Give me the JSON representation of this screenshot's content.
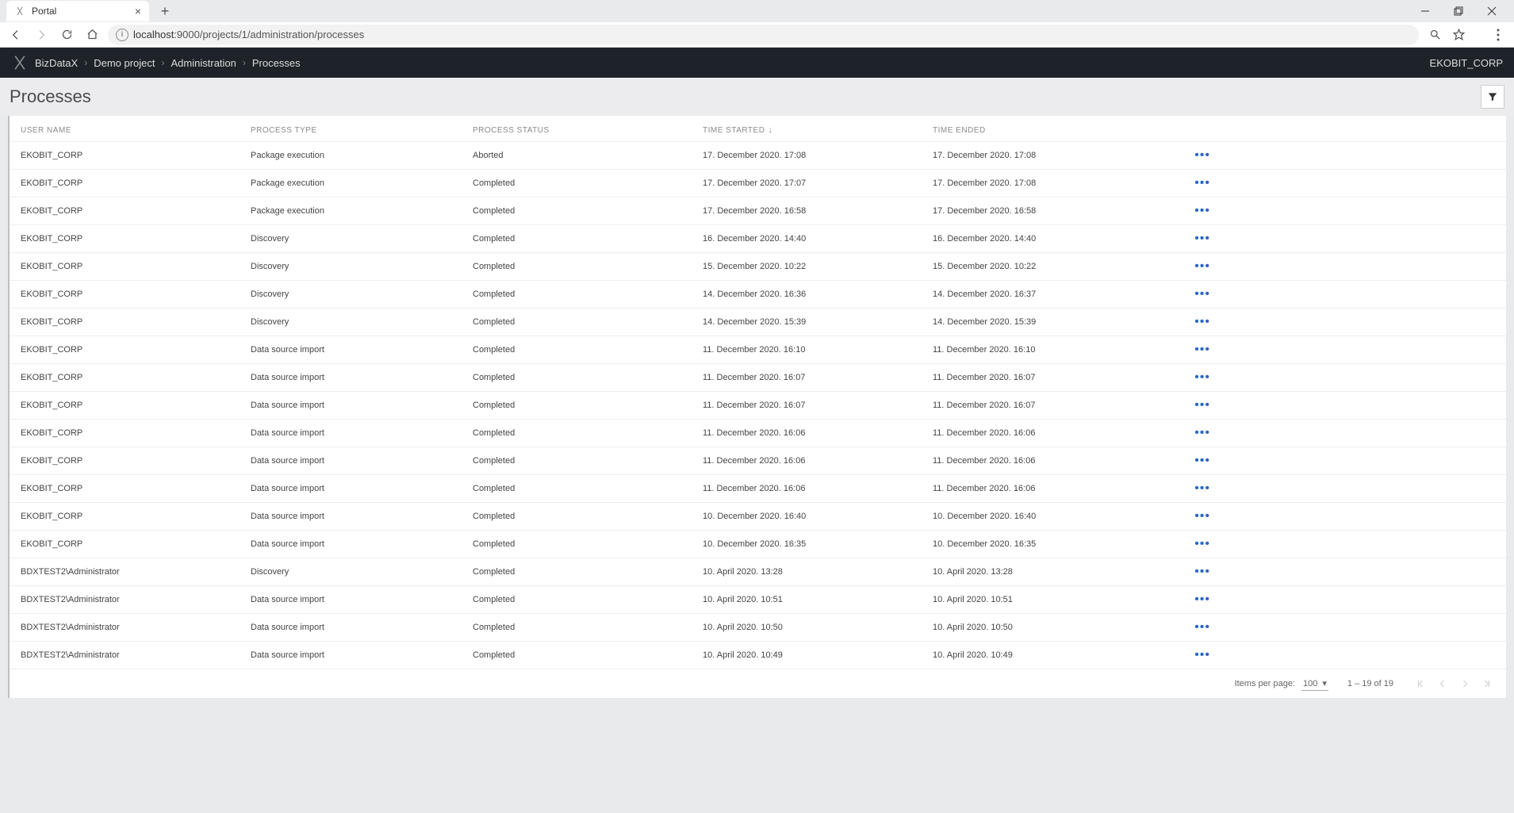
{
  "browser": {
    "tab_title": "Portal",
    "url_display_prefix": "localhost",
    "url_display_path": ":9000/projects/1/administration/processes"
  },
  "header": {
    "brand": "BizDataX",
    "breadcrumbs": [
      "Demo project",
      "Administration",
      "Processes"
    ],
    "user": "EKOBIT_CORP"
  },
  "page": {
    "title": "Processes"
  },
  "table": {
    "columns": {
      "user": "USER NAME",
      "type": "PROCESS TYPE",
      "status": "PROCESS STATUS",
      "started": "TIME STARTED",
      "ended": "TIME ENDED"
    },
    "sort_column": "started",
    "sort_dir": "desc",
    "rows": [
      {
        "user": "EKOBIT_CORP",
        "type": "Package execution",
        "status": "Aborted",
        "started": "17. December 2020. 17:08",
        "ended": "17. December 2020. 17:08"
      },
      {
        "user": "EKOBIT_CORP",
        "type": "Package execution",
        "status": "Completed",
        "started": "17. December 2020. 17:07",
        "ended": "17. December 2020. 17:08"
      },
      {
        "user": "EKOBIT_CORP",
        "type": "Package execution",
        "status": "Completed",
        "started": "17. December 2020. 16:58",
        "ended": "17. December 2020. 16:58"
      },
      {
        "user": "EKOBIT_CORP",
        "type": "Discovery",
        "status": "Completed",
        "started": "16. December 2020. 14:40",
        "ended": "16. December 2020. 14:40"
      },
      {
        "user": "EKOBIT_CORP",
        "type": "Discovery",
        "status": "Completed",
        "started": "15. December 2020. 10:22",
        "ended": "15. December 2020. 10:22"
      },
      {
        "user": "EKOBIT_CORP",
        "type": "Discovery",
        "status": "Completed",
        "started": "14. December 2020. 16:36",
        "ended": "14. December 2020. 16:37"
      },
      {
        "user": "EKOBIT_CORP",
        "type": "Discovery",
        "status": "Completed",
        "started": "14. December 2020. 15:39",
        "ended": "14. December 2020. 15:39"
      },
      {
        "user": "EKOBIT_CORP",
        "type": "Data source import",
        "status": "Completed",
        "started": "11. December 2020. 16:10",
        "ended": "11. December 2020. 16:10"
      },
      {
        "user": "EKOBIT_CORP",
        "type": "Data source import",
        "status": "Completed",
        "started": "11. December 2020. 16:07",
        "ended": "11. December 2020. 16:07"
      },
      {
        "user": "EKOBIT_CORP",
        "type": "Data source import",
        "status": "Completed",
        "started": "11. December 2020. 16:07",
        "ended": "11. December 2020. 16:07"
      },
      {
        "user": "EKOBIT_CORP",
        "type": "Data source import",
        "status": "Completed",
        "started": "11. December 2020. 16:06",
        "ended": "11. December 2020. 16:06"
      },
      {
        "user": "EKOBIT_CORP",
        "type": "Data source import",
        "status": "Completed",
        "started": "11. December 2020. 16:06",
        "ended": "11. December 2020. 16:06"
      },
      {
        "user": "EKOBIT_CORP",
        "type": "Data source import",
        "status": "Completed",
        "started": "11. December 2020. 16:06",
        "ended": "11. December 2020. 16:06"
      },
      {
        "user": "EKOBIT_CORP",
        "type": "Data source import",
        "status": "Completed",
        "started": "10. December 2020. 16:40",
        "ended": "10. December 2020. 16:40"
      },
      {
        "user": "EKOBIT_CORP",
        "type": "Data source import",
        "status": "Completed",
        "started": "10. December 2020. 16:35",
        "ended": "10. December 2020. 16:35"
      },
      {
        "user": "BDXTEST2\\Administrator",
        "type": "Discovery",
        "status": "Completed",
        "started": "10. April 2020. 13:28",
        "ended": "10. April 2020. 13:28"
      },
      {
        "user": "BDXTEST2\\Administrator",
        "type": "Data source import",
        "status": "Completed",
        "started": "10. April 2020. 10:51",
        "ended": "10. April 2020. 10:51"
      },
      {
        "user": "BDXTEST2\\Administrator",
        "type": "Data source import",
        "status": "Completed",
        "started": "10. April 2020. 10:50",
        "ended": "10. April 2020. 10:50"
      },
      {
        "user": "BDXTEST2\\Administrator",
        "type": "Data source import",
        "status": "Completed",
        "started": "10. April 2020. 10:49",
        "ended": "10. April 2020. 10:49"
      }
    ]
  },
  "pagination": {
    "items_per_page_label": "Items per page:",
    "items_per_page_value": "100",
    "range_text": "1 – 19 of 19"
  }
}
